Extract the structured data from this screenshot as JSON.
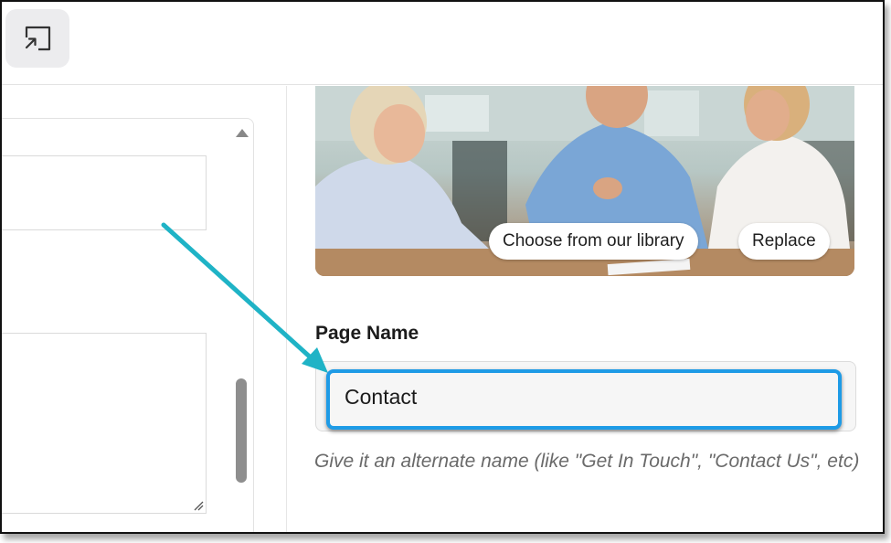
{
  "toolbar": {
    "expand_icon": "expand-icon"
  },
  "image_panel": {
    "library_button": "Choose from our library",
    "replace_button": "Replace"
  },
  "page_name": {
    "label": "Page Name",
    "value": "Contact",
    "help": "Give it an alternate name (like \"Get In Touch\", \"Contact Us\", etc)"
  },
  "colors": {
    "focus": "#1e9be6",
    "annotation_arrow": "#1fb3c6"
  }
}
